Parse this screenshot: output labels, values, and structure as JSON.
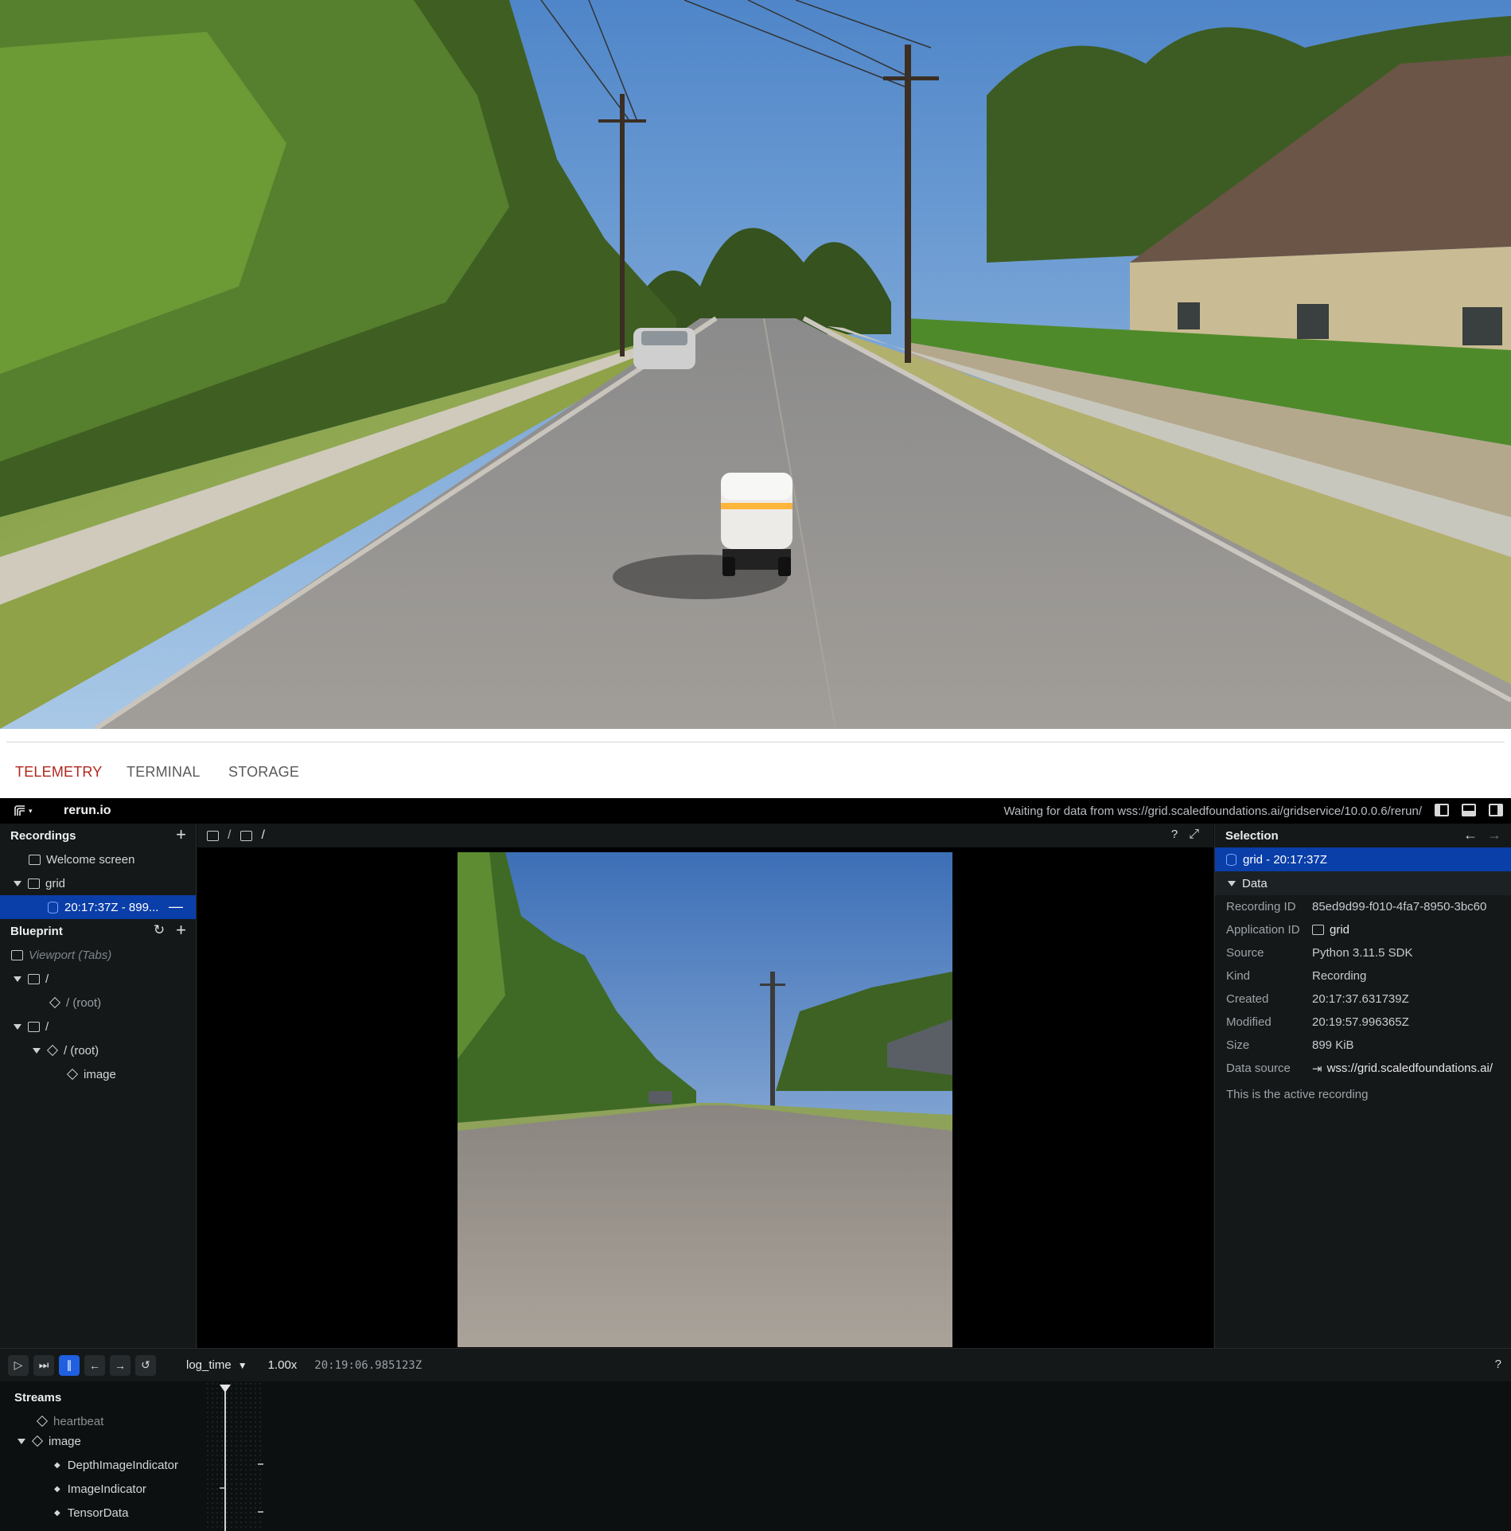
{
  "tabs": [
    "TELEMETRY",
    "TERMINAL",
    "STORAGE"
  ],
  "app": {
    "name": "rerun.io",
    "status": "Waiting for data from wss://grid.scaledfoundations.ai/gridservice/10.0.0.6/rerun/"
  },
  "recordings": {
    "title": "Recordings",
    "items": [
      {
        "label": "Welcome screen"
      },
      {
        "label": "grid"
      },
      {
        "label": "20:17:37Z - 899..."
      }
    ]
  },
  "blueprint": {
    "title": "Blueprint",
    "viewport": "Viewport (Tabs)",
    "items": [
      "/",
      "/ (root)",
      "/",
      "/ (root)",
      "image"
    ]
  },
  "viewport": {
    "crumb1": "/",
    "crumb2": "/",
    "help": "?"
  },
  "selection": {
    "title": "Selection",
    "item": "grid - 20:17:37Z",
    "section": "Data",
    "fields": [
      {
        "k": "Recording ID",
        "v": "85ed9d99-f010-4fa7-8950-3bc60"
      },
      {
        "k": "Application ID",
        "v": "grid"
      },
      {
        "k": "Source",
        "v": "Python 3.11.5 SDK"
      },
      {
        "k": "Kind",
        "v": "Recording"
      },
      {
        "k": "Created",
        "v": "20:17:37.631739Z"
      },
      {
        "k": "Modified",
        "v": "20:19:57.996365Z"
      },
      {
        "k": "Size",
        "v": "899 KiB"
      },
      {
        "k": "Data source",
        "v": "wss://grid.scaledfoundations.ai/"
      }
    ],
    "note": "This is the active recording"
  },
  "time": {
    "timeline": "log_time",
    "speed": "1.00x",
    "stamp": "20:19:06.985123Z",
    "help": "?"
  },
  "streams": {
    "title": "Streams",
    "items": [
      "heartbeat",
      "image",
      "DepthImageIndicator",
      "ImageIndicator",
      "TensorData"
    ]
  },
  "colors": {
    "accent_tab": "#b3261e",
    "selection_blue": "#0a3ea8",
    "play_active": "#1f5fe0"
  }
}
